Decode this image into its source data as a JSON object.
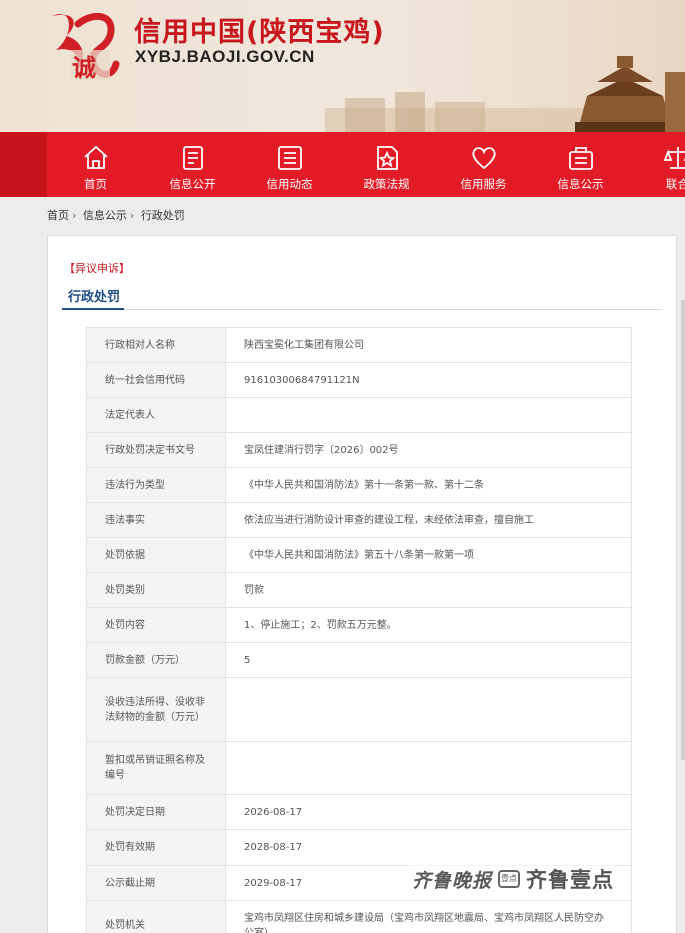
{
  "header": {
    "title": "信用中国(陕西宝鸡)",
    "url": "XYBJ.BAOJI.GOV.CN",
    "brand_color": "#c8161d",
    "nav_color": "#e21b26"
  },
  "nav": [
    {
      "label": "首页",
      "icon": "home-icon"
    },
    {
      "label": "信息公开",
      "icon": "document-icon"
    },
    {
      "label": "信用动态",
      "icon": "list-icon"
    },
    {
      "label": "政策法规",
      "icon": "star-document-icon"
    },
    {
      "label": "信用服务",
      "icon": "heart-icon"
    },
    {
      "label": "信息公示",
      "icon": "bulletin-icon"
    },
    {
      "label": "联合",
      "icon": "scale-icon"
    }
  ],
  "breadcrumb": [
    "首页",
    "信息公示",
    "行政处罚"
  ],
  "objection_link": "【异议申诉】",
  "tab_title": "行政处罚",
  "rows": [
    {
      "key": "行政相对人名称",
      "value": "陕西宝冕化工集团有限公司"
    },
    {
      "key": "统一社会信用代码",
      "value": "91610300684791121N"
    },
    {
      "key": "法定代表人",
      "value": ""
    },
    {
      "key": "行政处罚决定书文号",
      "value": "宝凤住建消行罚字〔2026〕002号"
    },
    {
      "key": "违法行为类型",
      "value": "《中华人民共和国消防法》第十一条第一款、第十二条"
    },
    {
      "key": "违法事实",
      "value": "依法应当进行消防设计审查的建设工程，未经依法审查，擅自施工"
    },
    {
      "key": "处罚依据",
      "value": "《中华人民共和国消防法》第五十八条第一款第一项"
    },
    {
      "key": "处罚类别",
      "value": "罚款"
    },
    {
      "key": "处罚内容",
      "value": "1、停止施工；2、罚款五万元整。"
    },
    {
      "key": "罚款金额（万元）",
      "value": "5"
    },
    {
      "key": "没收违法所得、没收非法财物的金额（万元）",
      "value": ""
    },
    {
      "key": "暂扣或吊销证照名称及编号",
      "value": ""
    },
    {
      "key": "处罚决定日期",
      "value": "2026-08-17"
    },
    {
      "key": "处罚有效期",
      "value": "2028-08-17"
    },
    {
      "key": "公示截止期",
      "value": "2029-08-17"
    },
    {
      "key": "处罚机关",
      "value": "宝鸡市凤翔区住房和城乡建设局（宝鸡市凤翔区地震局、宝鸡市凤翔区人民防空办公室）"
    }
  ],
  "watermark": {
    "left": "齐鲁晚报",
    "badge": "壹点",
    "right": "齐鲁壹点"
  }
}
